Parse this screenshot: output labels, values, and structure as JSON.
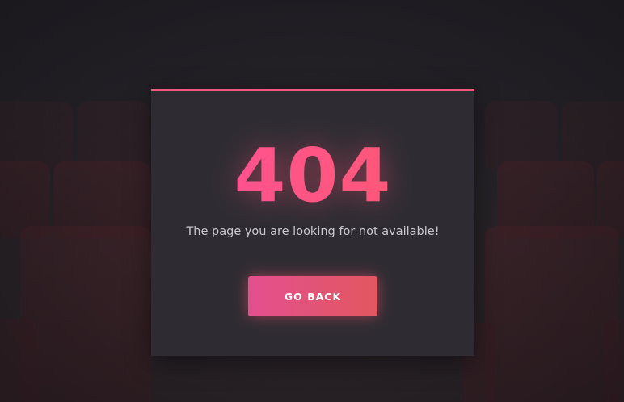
{
  "error": {
    "code": "404",
    "message": "The page you are looking for not available!"
  },
  "actions": {
    "go_back_label": "GO BACK"
  },
  "colors": {
    "background": "#232127",
    "card": "#2e2c32",
    "accent_start": "#ff4f9a",
    "accent_end": "#ff5b6e",
    "text_muted": "#c9c6cc"
  },
  "icons": [
    "cinema-seats-background"
  ]
}
